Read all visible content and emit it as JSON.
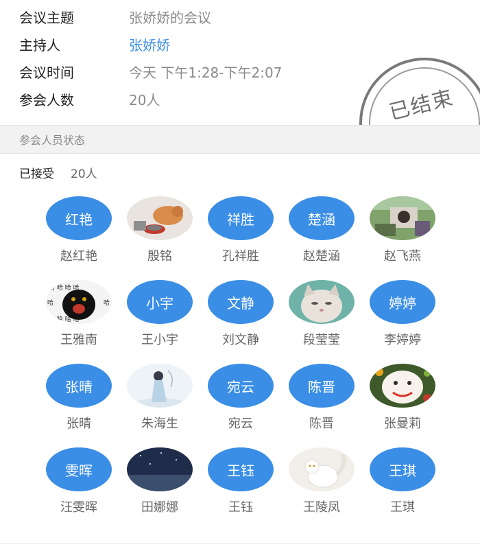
{
  "meeting": {
    "topic_label": "会议主题",
    "topic_value": "张娇娇的会议",
    "host_label": "主持人",
    "host_value": "张娇娇",
    "time_label": "会议时间",
    "time_value": "今天 下午1:28-下午2:07",
    "count_label": "参会人数",
    "count_value": "20人",
    "stamp_text": "已结束"
  },
  "status_section": {
    "title": "参会人员状态",
    "accepted_label": "已接受",
    "accepted_count": "20人"
  },
  "colors": {
    "accent": "#3a8ee6"
  },
  "members": [
    {
      "avatar_text": "红艳",
      "name": "赵红艳"
    },
    {
      "avatar_icon": "cat-photo-avatar",
      "name": "殷铭"
    },
    {
      "avatar_text": "祥胜",
      "name": "孔祥胜"
    },
    {
      "avatar_text": "楚涵",
      "name": "赵楚涵"
    },
    {
      "avatar_icon": "outdoor-photo-avatar",
      "name": "赵飞燕"
    },
    {
      "avatar_icon": "black-cat-photo-avatar",
      "name": "王雅南"
    },
    {
      "avatar_text": "小宇",
      "name": "王小宇"
    },
    {
      "avatar_text": "文静",
      "name": "刘文静"
    },
    {
      "avatar_icon": "cat-face-photo-avatar",
      "name": "段莹莹"
    },
    {
      "avatar_text": "婷婷",
      "name": "李婷婷"
    },
    {
      "avatar_text": "张晴",
      "name": "张晴"
    },
    {
      "avatar_icon": "illustration-girl-avatar",
      "name": "朱海生"
    },
    {
      "avatar_text": "宛云",
      "name": "宛云"
    },
    {
      "avatar_text": "陈晋",
      "name": "陈晋"
    },
    {
      "avatar_icon": "fruit-plate-avatar",
      "name": "张曼莉"
    },
    {
      "avatar_text": "雯晖",
      "name": "汪雯晖"
    },
    {
      "avatar_icon": "night-sky-avatar",
      "name": "田娜娜"
    },
    {
      "avatar_text": "王钰",
      "name": "王钰"
    },
    {
      "avatar_icon": "white-cat-photo-avatar",
      "name": "王陵凤"
    },
    {
      "avatar_text": "王琪",
      "name": "王琪"
    }
  ]
}
